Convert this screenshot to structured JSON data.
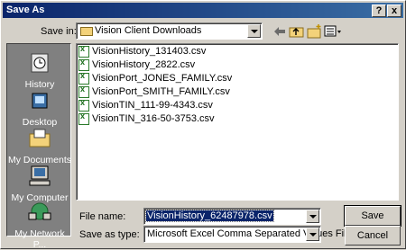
{
  "window": {
    "title": "Save As",
    "help_label": "?",
    "close_label": "x"
  },
  "save_in": {
    "label": "Save in:",
    "folder": "Vision Client Downloads"
  },
  "toolbar": {
    "icons": [
      "back-icon",
      "up-folder-icon",
      "new-folder-icon",
      "views-menu-icon"
    ]
  },
  "places": [
    {
      "label": "History",
      "icon": "history-icon"
    },
    {
      "label": "Desktop",
      "icon": "desktop-icon"
    },
    {
      "label": "My Documents",
      "icon": "my-documents-icon"
    },
    {
      "label": "My Computer",
      "icon": "my-computer-icon"
    },
    {
      "label": "My Network P...",
      "icon": "network-places-icon"
    }
  ],
  "files": [
    "VisionHistory_131403.csv",
    "VisionHistory_2822.csv",
    "VisionPort_JONES_FAMILY.csv",
    "VisionPort_SMITH_FAMILY.csv",
    "VisionTIN_111-99-4343.csv",
    "VisionTIN_316-50-3753.csv"
  ],
  "file_name": {
    "label": "File name:",
    "value": "VisionHistory_62487978.csv"
  },
  "save_as_type": {
    "label": "Save as type:",
    "value": "Microsoft Excel Comma Separated Values File"
  },
  "buttons": {
    "save": "Save",
    "cancel": "Cancel"
  },
  "colors": {
    "titlebar": "#0a246a",
    "face": "#d4d0c8",
    "sidebar": "#808080",
    "selection": "#0a246a"
  }
}
